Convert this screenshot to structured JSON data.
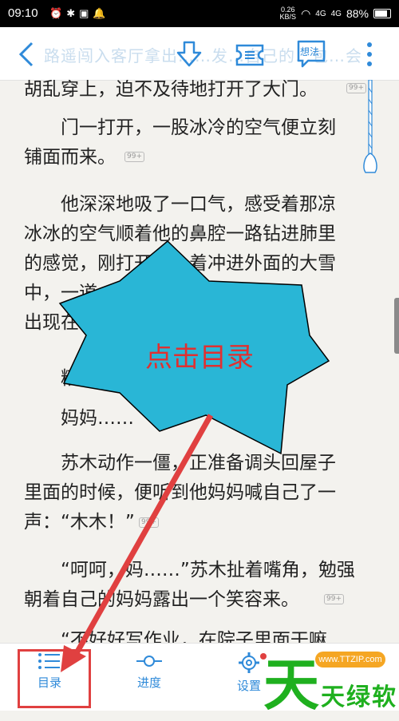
{
  "status_bar": {
    "time": "09:10",
    "net_speed_value": "0.26",
    "net_speed_unit": "KB/S",
    "signal_1": "4G",
    "signal_2": "4G",
    "battery": "88%"
  },
  "toolbar": {
    "title": "路遥闯入客厅拿出……发…自己的…包…会",
    "back_icon": "chevron-left-icon",
    "download_icon": "download-icon",
    "ticket_icon": "ticket-icon",
    "thoughts_label": "想法",
    "more_icon": "more-vertical-icon"
  },
  "paragraphs": [
    {
      "lines": [
        "胡乱穿上，迫不及待地打开了大门。"
      ],
      "comment": "99+"
    },
    {
      "lines": [
        "　　门一打开，一股冰冷的空气便立刻",
        "铺面而来。"
      ],
      "comment": "99+"
    },
    {
      "lines": [
        "　　他深深地吸了一口气，感受着那凉",
        "冰冰的空气顺着他的鼻腔一路钻进肺里",
        "的感觉，刚打开……着冲进外面的大雪",
        "中，一道……缓缓地",
        "出现在了……"
      ],
      "comment": ""
    },
    {
      "lines": [
        "　　糟……"
      ],
      "comment": ""
    },
    {
      "lines": [
        "　　妈妈……"
      ],
      "comment": ""
    },
    {
      "lines": [
        "　　苏木动作一僵，正准备调头回屋子",
        "里面的时候，便听到他妈妈喊自己了一",
        "声：“木木！”"
      ],
      "comment": "99+"
    },
    {
      "lines": [
        "　　“呵呵，妈……”苏木扯着嘴角，勉强",
        "朝着自己的妈妈露出一个笑容来。"
      ],
      "comment": "99+"
    },
    {
      "lines": [
        "　　“不好好写作业，在院子里面干嘛"
      ],
      "comment": ""
    }
  ],
  "annotation": {
    "callout_text": "点击目录",
    "callout_color": "#29b6d6",
    "text_color": "#e03030",
    "arrow_color": "#e04040"
  },
  "bottom_bar": {
    "items": [
      {
        "label": "目录",
        "icon": "list-icon"
      },
      {
        "label": "进度",
        "icon": "progress-slider-icon"
      },
      {
        "label": "设置",
        "icon": "gear-icon"
      }
    ]
  },
  "watermark": {
    "char1": "天",
    "char2": "天",
    "char3": "绿",
    "char4": "软",
    "site": "www.TTZIP.com"
  }
}
